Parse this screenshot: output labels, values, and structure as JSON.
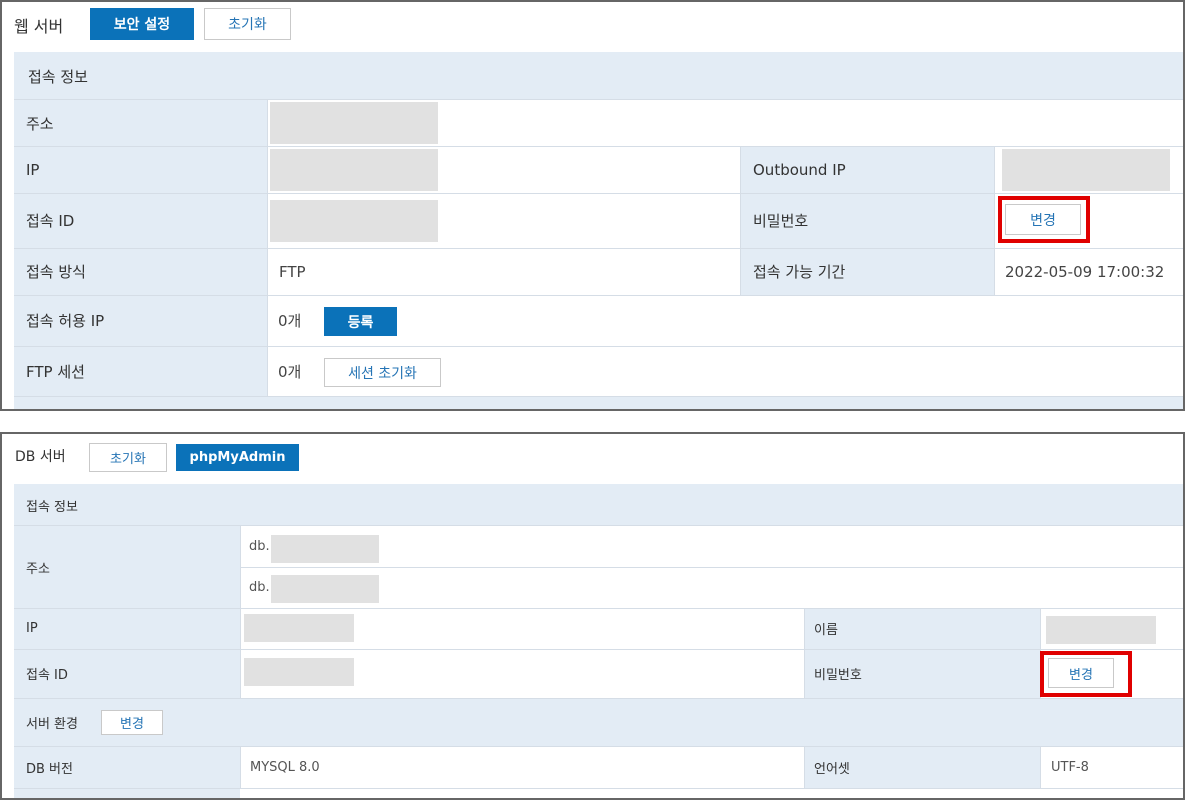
{
  "web": {
    "title": "웹 서버",
    "security_btn": "보안 설정",
    "reset_btn": "초기화",
    "section": "접속 정보",
    "address_label": "주소",
    "ip_label": "IP",
    "outbound_ip_label": "Outbound IP",
    "id_label": "접속 ID",
    "password_label": "비밀번호",
    "change_btn": "변경",
    "method_label": "접속 방식",
    "method_value": "FTP",
    "period_label": "접속 가능 기간",
    "period_value": "2022-05-09 17:00:32",
    "allowed_ip_label": "접속 허용 IP",
    "allowed_ip_count": "0개",
    "register_btn": "등록",
    "ftp_session_label": "FTP 세션",
    "ftp_session_count": "0개",
    "session_reset_btn": "세션 초기화"
  },
  "db": {
    "title": "DB 서버",
    "reset_btn": "초기화",
    "phpmyadmin_btn": "phpMyAdmin",
    "section": "접속 정보",
    "address_label": "주소",
    "address_prefix_1": "db.",
    "address_prefix_2": "db.",
    "ip_label": "IP",
    "name_label": "이름",
    "id_label": "접속 ID",
    "password_label": "비밀번호",
    "change_btn": "변경",
    "env_label": "서버 환경",
    "env_change_btn": "변경",
    "version_label": "DB 버전",
    "version_value": "MYSQL 8.0",
    "charset_label": "언어셋",
    "charset_value": "UTF-8"
  },
  "colors": {
    "primary": "#0b72b9",
    "label_bg": "#e3ecf5",
    "highlight": "#e00000",
    "mask": "#e1e1e1"
  }
}
